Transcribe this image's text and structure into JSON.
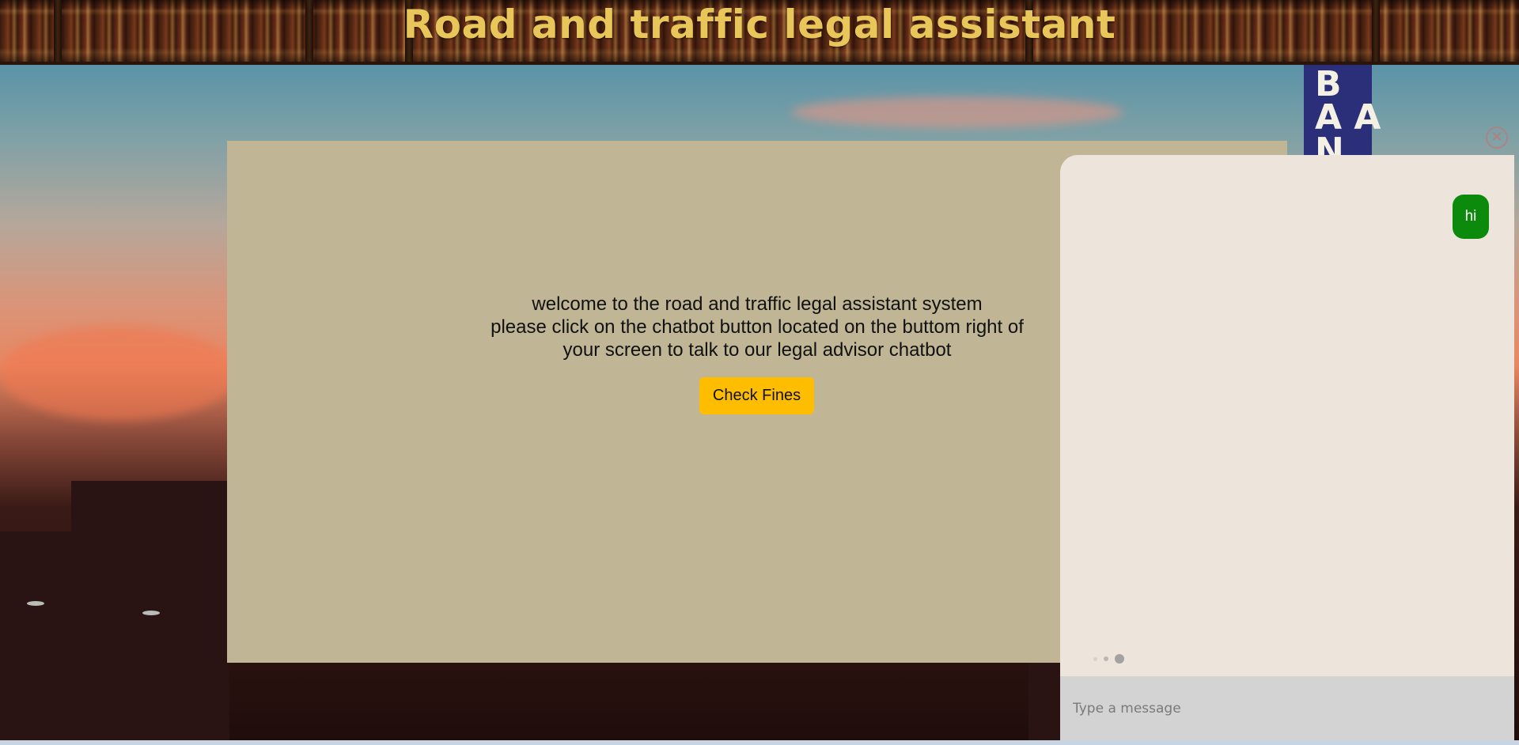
{
  "header": {
    "title": "Road and traffic legal assistant"
  },
  "background": {
    "sign_letters": "BAN A"
  },
  "main": {
    "welcome_line1": "welcome to the road and traffic legal assistant system",
    "welcome_line2": "please click on the chatbot button located on the buttom right of",
    "welcome_line3": "your screen to talk to our legal advisor chatbot",
    "check_fines_label": "Check Fines"
  },
  "chat": {
    "messages": [
      {
        "from": "user",
        "text": "hi"
      }
    ],
    "typing_indicator": true,
    "input_placeholder": "Type a message",
    "user_bubble_color": "#0b8a0b",
    "panel_color": "#ede4dc"
  },
  "colors": {
    "title": "#e8c65a",
    "card": "#c0b595",
    "button": "#ffbd00"
  },
  "icons": {
    "close": "close-icon"
  }
}
